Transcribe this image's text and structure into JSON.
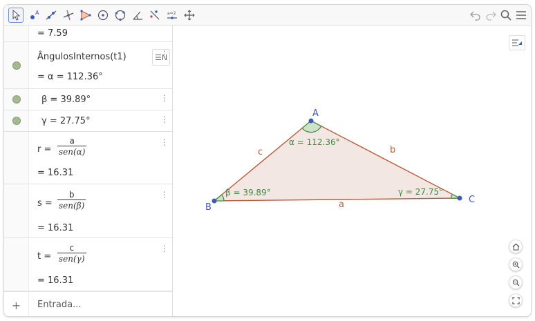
{
  "toolbar": {
    "tools": [
      "move-tool",
      "point-tool",
      "line-tool",
      "perpendicular-tool",
      "polygon-tool",
      "circle-center-tool",
      "circle-three-points-tool",
      "angle-tool",
      "reflect-tool",
      "slider-tool",
      "move-graphics-view-tool"
    ],
    "slider_label": "a=2"
  },
  "algebra": {
    "rows": [
      {
        "value": "= 7.59"
      },
      {
        "label": "ÂngulosInternos(t1)",
        "value": "= α = 112.36°"
      },
      {
        "value": "β = 39.89°"
      },
      {
        "value": "γ = 27.75°"
      },
      {
        "lhs": "r =",
        "num": "a",
        "den": "sen(α)",
        "value": "= 16.31"
      },
      {
        "lhs": "s =",
        "num": "b",
        "den": "sen(β)",
        "value": "= 16.31"
      },
      {
        "lhs": "t =",
        "num": "c",
        "den": "sen(γ)",
        "value": "= 16.31"
      }
    ],
    "menu_glyph": "⋮",
    "style_toggle": "☰N",
    "input": {
      "plus": "+",
      "placeholder": "Entrada..."
    }
  },
  "graphics": {
    "points": {
      "A": "A",
      "B": "B",
      "C": "C"
    },
    "sides": {
      "a": "a",
      "b": "b",
      "c": "c"
    },
    "angles": {
      "alpha": "α = 112.36°",
      "beta": "β = 39.89°",
      "gamma": "γ = 27.75°"
    },
    "colors": {
      "fill": "#f3e7e4",
      "edge": "#b95b3a",
      "point": "#3f5bb5",
      "angle": "#3c8a3c"
    }
  }
}
